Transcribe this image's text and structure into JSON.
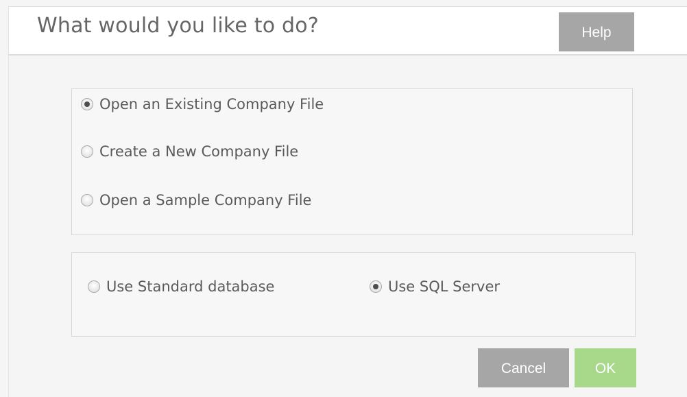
{
  "dialog": {
    "title": "What would you like to do?",
    "help_label": "Help"
  },
  "company_options": [
    {
      "label": "Open an Existing Company File",
      "checked": true
    },
    {
      "label": "Create a New Company File",
      "checked": false
    },
    {
      "label": "Open a Sample Company File",
      "checked": false
    }
  ],
  "database_options": [
    {
      "label": "Use Standard database",
      "checked": false
    },
    {
      "label": "Use SQL Server",
      "checked": true
    }
  ],
  "footer": {
    "cancel_label": "Cancel",
    "ok_label": "OK"
  },
  "colors": {
    "neutral_button": "#a6a6a6",
    "ok_button": "#a8d88a",
    "text": "#5a5a5a"
  }
}
